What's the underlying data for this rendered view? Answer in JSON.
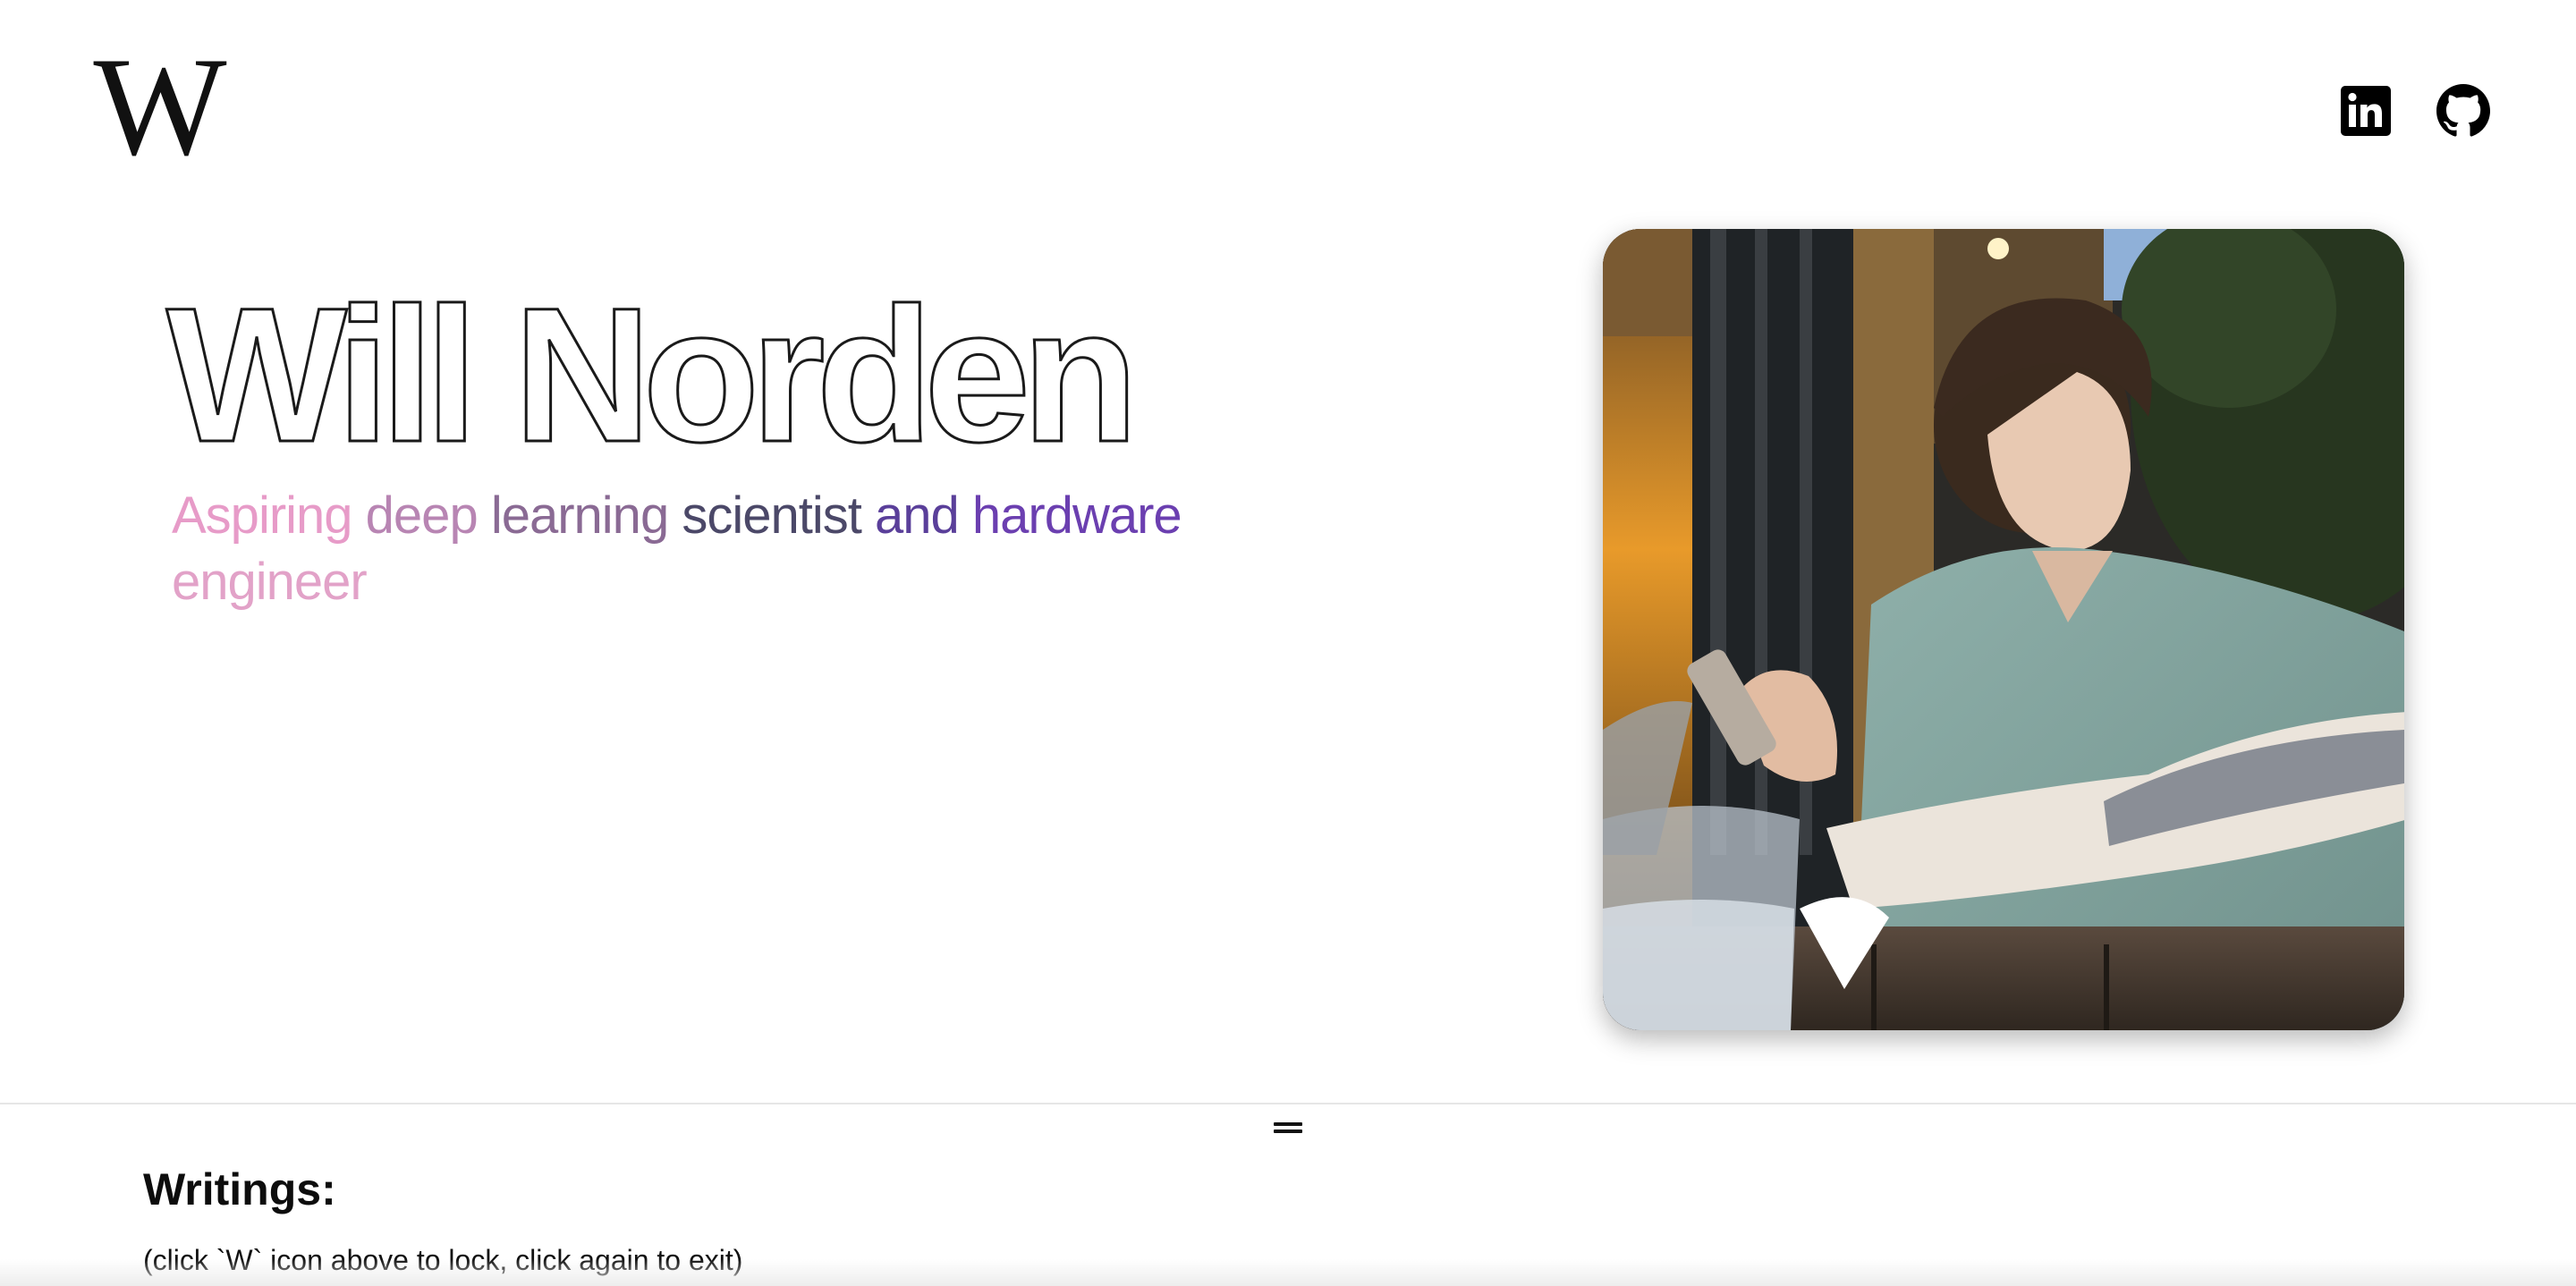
{
  "header": {
    "logo_text": "W",
    "social": [
      {
        "name": "LinkedIn",
        "icon": "linkedin-icon"
      },
      {
        "name": "GitHub",
        "icon": "github-icon"
      }
    ]
  },
  "hero": {
    "name": "Will Norden",
    "tagline_words": [
      {
        "text": "Aspiring",
        "color": "#e79bc8"
      },
      {
        "text": "deep",
        "color": "#b885b3"
      },
      {
        "text": "learning",
        "color": "#8a6a94"
      },
      {
        "text": "scientist",
        "color": "#4b4868"
      },
      {
        "text": "and",
        "color": "#5a3f9a"
      },
      {
        "text": "hardware",
        "color": "#6b3fb0"
      },
      {
        "text": "engineer",
        "color": "#e2a2c8"
      }
    ],
    "photo": {
      "icon": "portrait-photo"
    }
  },
  "drawer": {
    "title": "Writings:",
    "hint": "(click `W` icon above to lock, click again to exit)"
  },
  "colors": {
    "background": "#ffffff",
    "text": "#111111",
    "divider": "#e6e6e6"
  }
}
